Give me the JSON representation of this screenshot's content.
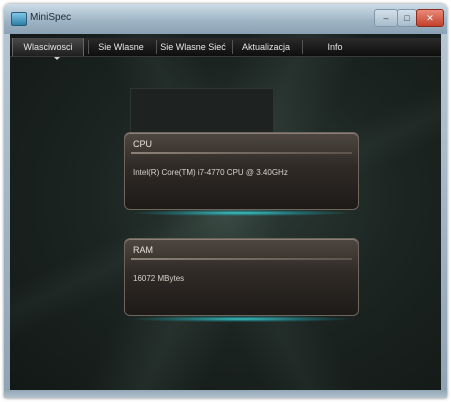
{
  "window": {
    "title": "MiniSpec",
    "buttons": {
      "minimize": "–",
      "maximize": "□",
      "close": "✕"
    }
  },
  "tabs": [
    {
      "label": "Wlasciwosci",
      "active": true
    },
    {
      "label": "Sie Wlasne",
      "active": false
    },
    {
      "label": "Sie Wlasne Sieć",
      "active": false
    },
    {
      "label": "Aktualizacja",
      "active": false
    },
    {
      "label": "Info",
      "active": false
    }
  ],
  "panels": [
    {
      "header": "CPU",
      "value": "Intel(R) Core(TM) i7-4770 CPU @ 3.40GHz"
    },
    {
      "header": "RAM",
      "value": "16072 MBytes"
    }
  ],
  "icons": {
    "app": "app-icon",
    "active_tab_marker": "caret-down-icon"
  },
  "colors": {
    "glow": "#3cd2d2",
    "background": "#1c2522",
    "panel": "#2f2a26"
  }
}
